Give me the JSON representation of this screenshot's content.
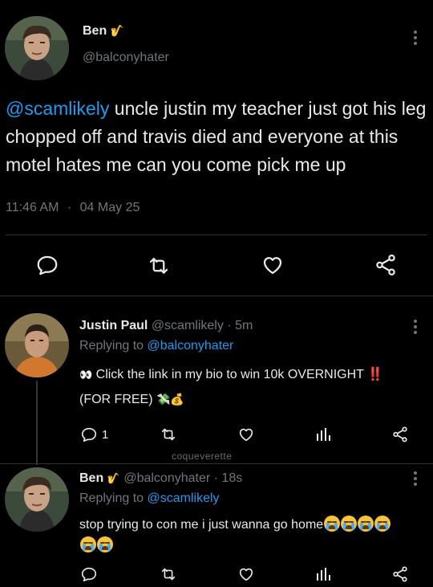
{
  "main_tweet": {
    "name": "Ben",
    "name_emoji": "🎷",
    "handle": "@balconyhater",
    "mention": "@scamlikely",
    "text": " uncle justin my teacher just got his leg chopped off and travis died and everyone at this motel hates me can you come pick me up",
    "time": "11:46 AM",
    "separator": "·",
    "date": "04 May 25"
  },
  "reply1": {
    "name": "Justin Paul",
    "handle": "@scamlikely",
    "separator": "·",
    "age": "5m",
    "replying_label": "Replying to ",
    "replying_to": "@balconyhater",
    "eyes_emoji": "👀",
    "text": " Click the link in my bio to win 10k OVERNIGHT ",
    "exclaim_emoji": "‼️",
    "text2": "(FOR FREE) ",
    "money_emoji": "💸💰",
    "reply_count": "1"
  },
  "watermark": "coqueverette",
  "reply2": {
    "name": "Ben",
    "name_emoji": "🎷",
    "handle": "@balconyhater",
    "separator": "·",
    "age": "18s",
    "replying_label": "Replying to ",
    "replying_to": "@scamlikely",
    "text": "stop trying to con me i just wanna go home"
  },
  "colors": {
    "background": "#000000",
    "text": "#e7e9ea",
    "muted": "#71767b",
    "link": "#1d9bf0",
    "divider": "#2f3336"
  },
  "icons": [
    "reply-icon",
    "retweet-icon",
    "like-icon",
    "share-icon",
    "views-icon",
    "more-options-icon"
  ]
}
